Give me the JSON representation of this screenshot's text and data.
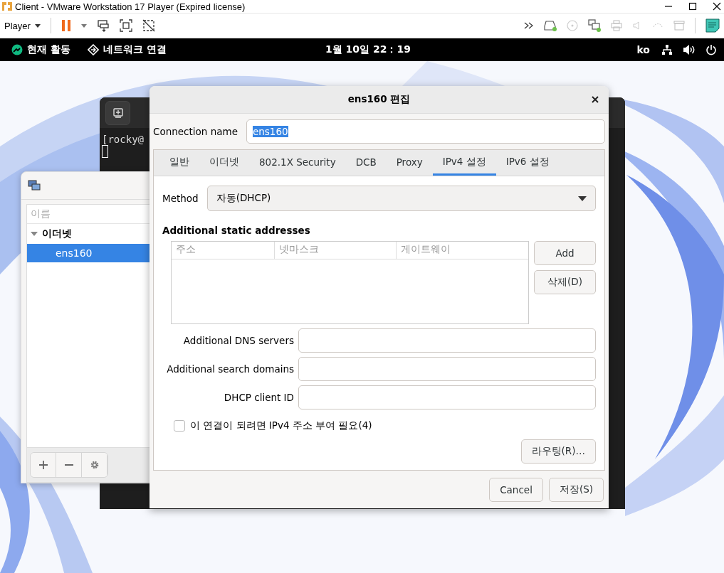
{
  "vmware": {
    "title": "Client - VMware Workstation 17 Player (Expired license)",
    "menu": "Player"
  },
  "topbar": {
    "activities": "현재 활동",
    "app": "네트워크 연결",
    "clock": "1월 10일 22：19",
    "lang": "ko"
  },
  "terminal": {
    "line": "[rocky@"
  },
  "connections": {
    "header": "이름",
    "groups": [
      {
        "label": "이더넷",
        "expanded": true,
        "children": [
          {
            "label": "ens160",
            "selected": true
          }
        ]
      }
    ]
  },
  "dialog": {
    "title": "ens160 편집",
    "name_label": "Connection name",
    "name_value": "ens160",
    "tabs": [
      {
        "label": "일반",
        "selected": false
      },
      {
        "label": "이더넷",
        "selected": false
      },
      {
        "label": "802.1X Security",
        "selected": false
      },
      {
        "label": "DCB",
        "selected": false
      },
      {
        "label": "Proxy",
        "selected": false
      },
      {
        "label": "IPv4 설정",
        "selected": true
      },
      {
        "label": "IPv6 설정",
        "selected": false
      }
    ],
    "method_label": "Method",
    "method_value": "자동(DHCP)",
    "addresses_heading": "Additional static addresses",
    "columns": [
      "주소",
      "넷마스크",
      "게이트웨이"
    ],
    "add": "Add",
    "delete": "삭제(D)",
    "fields": [
      {
        "label": "Additional DNS servers"
      },
      {
        "label": "Additional search domains"
      },
      {
        "label": "DHCP client ID"
      }
    ],
    "checkbox": {
      "label": "이 연결이 되려면 IPv4 주소 부여 필요(4)",
      "checked": false
    },
    "routes": "라우팅(R)…",
    "cancel": "Cancel",
    "save": "저장(S)"
  }
}
